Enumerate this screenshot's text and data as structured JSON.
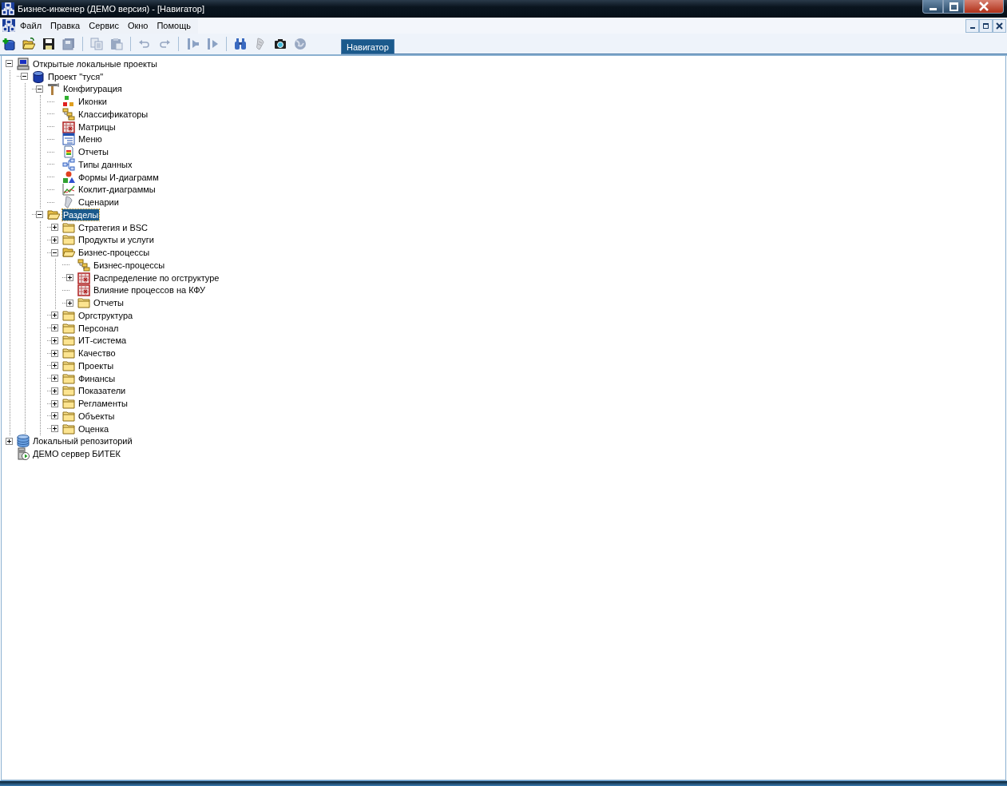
{
  "window": {
    "title": "Бизнес-инженер (ДЕМО версия) - [Навигатор]"
  },
  "menu": [
    "Файл",
    "Правка",
    "Сервис",
    "Окно",
    "Помощь"
  ],
  "toolbar": [
    {
      "kind": "add-project",
      "disabled": false
    },
    {
      "kind": "open",
      "disabled": false
    },
    {
      "kind": "save",
      "disabled": false
    },
    {
      "kind": "save-all",
      "disabled": true
    },
    {
      "kind": "separator"
    },
    {
      "kind": "copy",
      "disabled": true
    },
    {
      "kind": "paste",
      "disabled": true
    },
    {
      "kind": "separator"
    },
    {
      "kind": "undo",
      "disabled": true
    },
    {
      "kind": "redo",
      "disabled": true
    },
    {
      "kind": "separator"
    },
    {
      "kind": "back",
      "disabled": true
    },
    {
      "kind": "forward",
      "disabled": true
    },
    {
      "kind": "separator"
    },
    {
      "kind": "find",
      "disabled": false
    },
    {
      "kind": "scenario",
      "disabled": true
    },
    {
      "kind": "camera",
      "disabled": false
    },
    {
      "kind": "globe",
      "disabled": true
    }
  ],
  "tabs": [
    {
      "label": "Навигатор",
      "selected": true
    }
  ],
  "tree": [
    {
      "label": "Открытые локальные проекты",
      "kind": "computer",
      "expanded": true,
      "selected": false,
      "children": [
        {
          "label": "Проект \"туся\"",
          "kind": "database",
          "expanded": true,
          "selected": false,
          "children": [
            {
              "label": "Конфигурация",
              "kind": "tools",
              "expanded": true,
              "selected": false,
              "children": [
                {
                  "label": "Иконки",
                  "kind": "tiles",
                  "selected": false
                },
                {
                  "label": "Классификаторы",
                  "kind": "classifier",
                  "selected": false
                },
                {
                  "label": "Матрицы",
                  "kind": "matrix",
                  "selected": false
                },
                {
                  "label": "Меню",
                  "kind": "menu",
                  "selected": false
                },
                {
                  "label": "Отчеты",
                  "kind": "report",
                  "selected": false
                },
                {
                  "label": "Типы данных",
                  "kind": "datatypes",
                  "selected": false
                },
                {
                  "label": "Формы И-диаграмм",
                  "kind": "shapes",
                  "selected": false
                },
                {
                  "label": "Коклит-диаграммы",
                  "kind": "chart",
                  "selected": false
                },
                {
                  "label": "Сценарии",
                  "kind": "scenario",
                  "selected": false
                }
              ]
            },
            {
              "label": "Разделы",
              "kind": "folder",
              "expanded": true,
              "selected": true,
              "children": [
                {
                  "label": "Стратегия и BSC",
                  "kind": "folder",
                  "expanded": false,
                  "selected": false
                },
                {
                  "label": "Продукты и услуги",
                  "kind": "folder",
                  "expanded": false,
                  "selected": false
                },
                {
                  "label": "Бизнес-процессы",
                  "kind": "folder",
                  "expanded": true,
                  "selected": false,
                  "children": [
                    {
                      "label": "Бизнес-процессы",
                      "kind": "classifier",
                      "selected": false
                    },
                    {
                      "label": "Распределение по огструктуре",
                      "kind": "matrix",
                      "expanded": false,
                      "selected": false
                    },
                    {
                      "label": "Влияние процессов на КФУ",
                      "kind": "matrix",
                      "selected": false
                    },
                    {
                      "label": "Отчеты",
                      "kind": "folder",
                      "expanded": false,
                      "selected": false
                    }
                  ]
                },
                {
                  "label": "Оргструктура",
                  "kind": "folder",
                  "expanded": false,
                  "selected": false
                },
                {
                  "label": "Персонал",
                  "kind": "folder",
                  "expanded": false,
                  "selected": false
                },
                {
                  "label": "ИТ-система",
                  "kind": "folder",
                  "expanded": false,
                  "selected": false
                },
                {
                  "label": "Качество",
                  "kind": "folder",
                  "expanded": false,
                  "selected": false
                },
                {
                  "label": "Проекты",
                  "kind": "folder",
                  "expanded": false,
                  "selected": false
                },
                {
                  "label": "Финансы",
                  "kind": "folder",
                  "expanded": false,
                  "selected": false
                },
                {
                  "label": "Показатели",
                  "kind": "folder",
                  "expanded": false,
                  "selected": false
                },
                {
                  "label": "Регламенты",
                  "kind": "folder",
                  "expanded": false,
                  "selected": false
                },
                {
                  "label": "Объекты",
                  "kind": "folder",
                  "expanded": false,
                  "selected": false
                },
                {
                  "label": "Оценка",
                  "kind": "folder",
                  "expanded": false,
                  "selected": false
                }
              ]
            }
          ]
        }
      ]
    },
    {
      "label": "Локальный репозиторий",
      "kind": "repository",
      "expanded": false,
      "selected": false
    },
    {
      "label": "ДЕМО сервер БИТЕК",
      "kind": "server",
      "selected": false
    }
  ]
}
